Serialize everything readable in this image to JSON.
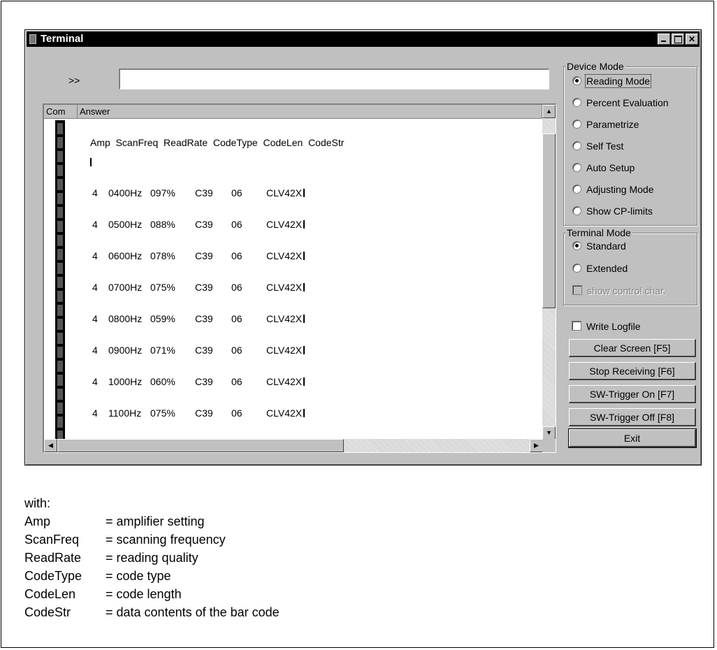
{
  "window": {
    "title": "Terminal"
  },
  "prompt": ">>",
  "command_value": "",
  "terminal": {
    "col_com": "Com",
    "col_answer": "Answer",
    "header_line": "Amp  ScanFreq  ReadRate  CodeType  CodeLen  CodeStr",
    "rows": [
      [
        "4",
        "0400Hz",
        "097%",
        "C39",
        "06",
        "CLV42X"
      ],
      [
        "4",
        "0500Hz",
        "088%",
        "C39",
        "06",
        "CLV42X"
      ],
      [
        "4",
        "0600Hz",
        "078%",
        "C39",
        "06",
        "CLV42X"
      ],
      [
        "4",
        "0700Hz",
        "075%",
        "C39",
        "06",
        "CLV42X"
      ],
      [
        "4",
        "0800Hz",
        "059%",
        "C39",
        "06",
        "CLV42X"
      ],
      [
        "4",
        "0900Hz",
        "071%",
        "C39",
        "06",
        "CLV42X"
      ],
      [
        "4",
        "1000Hz",
        "060%",
        "C39",
        "06",
        "CLV42X"
      ],
      [
        "4",
        "1100Hz",
        "075%",
        "C39",
        "06",
        "CLV42X"
      ]
    ]
  },
  "device_mode": {
    "title": "Device Mode",
    "options": [
      "Reading Mode",
      "Percent Evaluation",
      "Parametrize",
      "Self Test",
      "Auto Setup",
      "Adjusting Mode",
      "Show CP-limits"
    ],
    "selected": "Reading Mode"
  },
  "terminal_mode": {
    "title": "Terminal Mode",
    "options": [
      "Standard",
      "Extended"
    ],
    "selected": "Standard",
    "show_control_char": "show control char."
  },
  "write_logfile": "Write Logfile",
  "buttons": {
    "clear": "Clear Screen [F5]",
    "stop": "Stop Receiving [F6]",
    "trigger_on": "SW-Trigger On [F7]",
    "trigger_off": "SW-Trigger Off [F8]",
    "exit": "Exit"
  },
  "legend": {
    "with": "with:",
    "items": [
      [
        "Amp",
        "= amplifier setting"
      ],
      [
        "ScanFreq",
        "= scanning frequency"
      ],
      [
        "ReadRate",
        "= reading quality"
      ],
      [
        "CodeType",
        "= code type"
      ],
      [
        "CodeLen",
        "= code length"
      ],
      [
        "CodeStr",
        "= data contents of the bar code"
      ]
    ]
  }
}
